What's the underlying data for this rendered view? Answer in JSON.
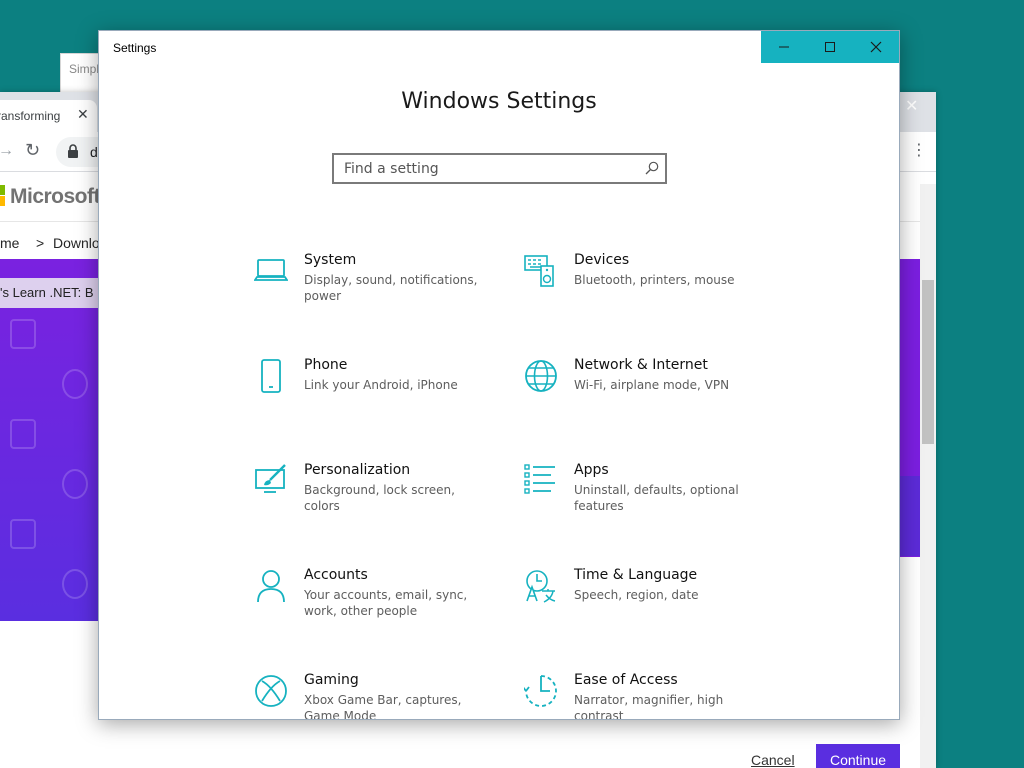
{
  "background_windows": {
    "simple_window_title": "Simpl",
    "browser": {
      "tab_title": "ransforming",
      "url_partial": "d",
      "site_logo": "Microsoft",
      "breadcrumb": [
        "me",
        ">",
        "Downlo"
      ],
      "banner_text": "'s Learn .NET: B",
      "cancel_label": "Cancel",
      "continue_label": "Continue"
    }
  },
  "settings": {
    "window_title": "Settings",
    "heading": "Windows Settings",
    "search_placeholder": "Find a setting",
    "accent_color": "#16b2c0",
    "tiles": [
      {
        "name": "System",
        "description": "Display, sound, notifications, power",
        "icon": "laptop-icon"
      },
      {
        "name": "Devices",
        "description": "Bluetooth, printers, mouse",
        "icon": "keyboard-speaker-icon"
      },
      {
        "name": "Phone",
        "description": "Link your Android, iPhone",
        "icon": "phone-icon"
      },
      {
        "name": "Network & Internet",
        "description": "Wi-Fi, airplane mode, VPN",
        "icon": "globe-icon"
      },
      {
        "name": "Personalization",
        "description": "Background, lock screen, colors",
        "icon": "brush-screen-icon"
      },
      {
        "name": "Apps",
        "description": "Uninstall, defaults, optional features",
        "icon": "apps-list-icon"
      },
      {
        "name": "Accounts",
        "description": "Your accounts, email, sync, work, other people",
        "icon": "person-icon"
      },
      {
        "name": "Time & Language",
        "description": "Speech, region, date",
        "icon": "time-language-icon"
      },
      {
        "name": "Gaming",
        "description": "Xbox Game Bar, captures, Game Mode",
        "icon": "xbox-icon"
      },
      {
        "name": "Ease of Access",
        "description": "Narrator, magnifier, high contrast",
        "icon": "ease-of-access-icon"
      }
    ]
  }
}
